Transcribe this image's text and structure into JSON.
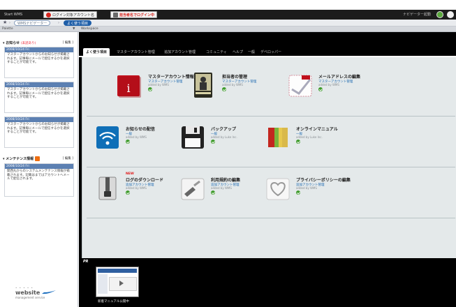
{
  "topbar": {
    "app_name": "Start WMS",
    "login_label": "ログイン対象アカウント名",
    "admin_label": "担当者名でログイン中",
    "right_label": "ナビゲーター起動"
  },
  "breadcrumb": {
    "first": "WMSナビゲーター",
    "second": "よく使う項目"
  },
  "panel": {
    "palette_label": "Palette",
    "workspace_label": "Workspace"
  },
  "sidebar": {
    "notices_title": "お知らせ",
    "notices_sub": "(未読あり)",
    "edit_label": "[ 編集 ]",
    "notices": [
      {
        "date": "2008/10/24 Fri",
        "text": "マスターアカウントからのお知らせが掲載されます。記事毎にメールで配信するかを選択することが可能です。"
      },
      {
        "date": "2008/10/24 Fri",
        "text": "マスターアカウントからのお知らせが掲載されます。記事毎にメールで配信するかを選択することが可能です。"
      },
      {
        "date": "2008/10/24 Fri",
        "text": "マスターアカウントからのお知らせが掲載されます。記事毎にメールで配信するかを選択することが可能です。"
      }
    ],
    "maintenance_title": "メンテナンス情報",
    "maintenance": {
      "date": "2008/10/24 Fri",
      "text": "関西丸からのシステムメンテナンス情報が掲載されます。記載はまではアカウントへメールで配信されます。"
    },
    "logo_text": "website",
    "logo_sub": "management service"
  },
  "tabs": [
    "よく使う項目",
    "マスターアカウント管理",
    "追加アカウント管理",
    "コミュニティ",
    "ヘルプ",
    "一般",
    "デベロッパー"
  ],
  "cards": [
    {
      "title": "マスターアカウント情報",
      "category": "マスターアカウント管理",
      "by": "added by WMS",
      "icon": "info-icon",
      "new": ""
    },
    {
      "title": "担当者の管理",
      "category": "マスターアカウント管理",
      "by": "added by WMS",
      "icon": "person-icon",
      "new": ""
    },
    {
      "title": "メールアドレスの編集",
      "category": "マスターアカウント管理",
      "by": "added by WMS",
      "icon": "mail-icon",
      "new": ""
    },
    {
      "title": "お知らせの配信",
      "category": "一般",
      "by": "added by WMS",
      "icon": "wireless-icon",
      "new": ""
    },
    {
      "title": "バックアップ",
      "category": "一般",
      "by": "added by Luke Inc.",
      "icon": "floppy-icon",
      "new": ""
    },
    {
      "title": "オンラインマニュアル",
      "category": "一般",
      "by": "added by Luke Inc.",
      "icon": "book-icon",
      "new": ""
    },
    {
      "title": "ログのダウンロード",
      "category": "追加アカウント管理",
      "by": "added by WMS",
      "icon": "zip-icon",
      "new": "NEW"
    },
    {
      "title": "利用規約の編集",
      "category": "追加アカウント管理",
      "by": "added by WMS",
      "icon": "edit-icon",
      "new": ""
    },
    {
      "title": "プライバシーポリシーの編集",
      "category": "追加アカウント管理",
      "by": "added by WMS",
      "icon": "heart-icon",
      "new": ""
    }
  ],
  "pr": {
    "label": "PR",
    "caption": "新着マニュアル公開中"
  }
}
